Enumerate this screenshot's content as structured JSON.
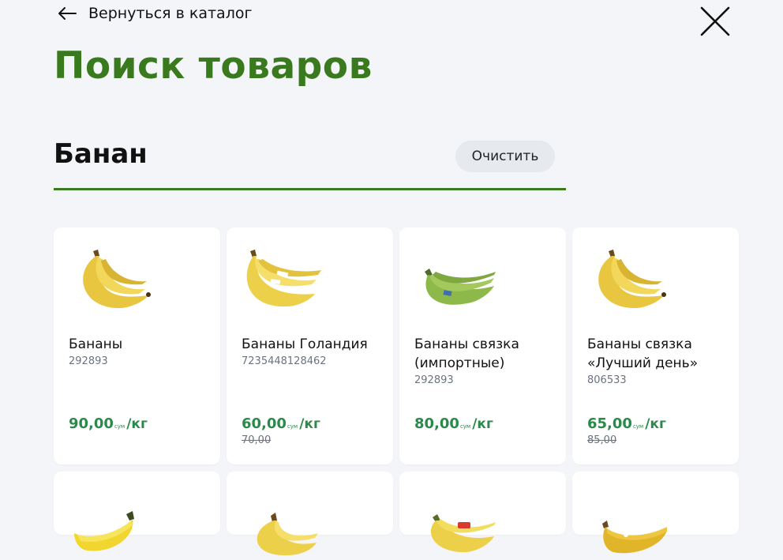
{
  "nav": {
    "back_label": "Вернуться в каталог"
  },
  "page": {
    "title": "Поиск товаров"
  },
  "search": {
    "value": "Банан",
    "clear_label": "Очистить"
  },
  "colors": {
    "accent": "#3a7a1e",
    "price": "#2b8a4a",
    "background": "#f4f5f8"
  },
  "products": [
    {
      "name": "Бананы",
      "sku": "292893",
      "price": "90,00",
      "currency": "сум",
      "unit": "/кг",
      "old_price": ""
    },
    {
      "name": "Бананы Голандия",
      "sku": "7235448128462",
      "price": "60,00",
      "currency": "сум",
      "unit": "/кг",
      "old_price": "70,00"
    },
    {
      "name": "Бананы связка (импортные)",
      "sku": "292893",
      "price": "80,00",
      "currency": "сум",
      "unit": "/кг",
      "old_price": ""
    },
    {
      "name": "Бананы связка «Лучший день»",
      "sku": "806533",
      "price": "65,00",
      "currency": "сум",
      "unit": "/кг",
      "old_price": "85,00"
    }
  ]
}
